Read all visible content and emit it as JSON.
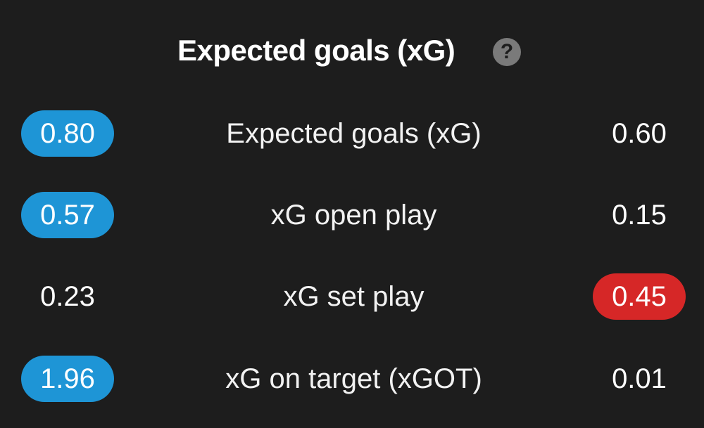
{
  "header": {
    "title": "Expected goals (xG)",
    "help_icon": "question-circle-icon",
    "help_glyph": "?"
  },
  "colors": {
    "background": "#1d1d1d",
    "highlight_home": "#1e95d6",
    "highlight_away": "#d62727",
    "help_icon": "#7a7a7a"
  },
  "rows": [
    {
      "label": "Expected goals (xG)",
      "home": "0.80",
      "away": "0.60",
      "highlight": "home"
    },
    {
      "label": "xG open play",
      "home": "0.57",
      "away": "0.15",
      "highlight": "home"
    },
    {
      "label": "xG set play",
      "home": "0.23",
      "away": "0.45",
      "highlight": "away"
    },
    {
      "label": "xG on target (xGOT)",
      "home": "1.96",
      "away": "0.01",
      "highlight": "home"
    }
  ]
}
